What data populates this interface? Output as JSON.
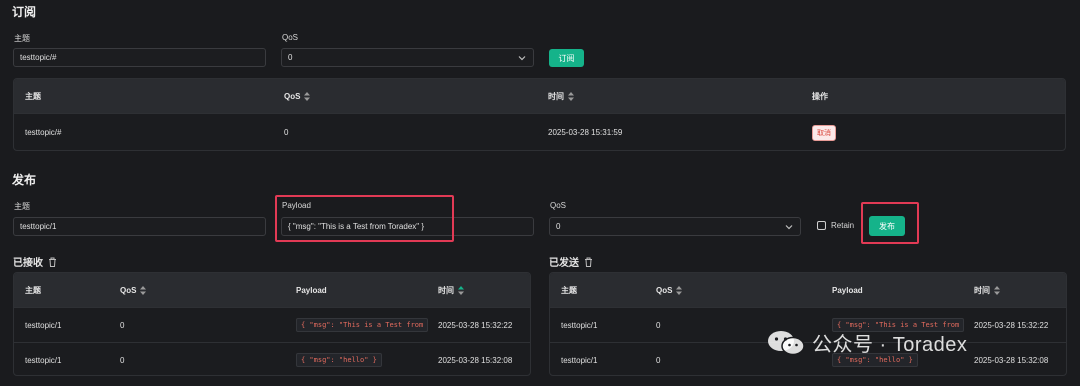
{
  "subscribe": {
    "title": "订阅",
    "topic_label": "主题",
    "topic_value": "testtopic/#",
    "qos_label": "QoS",
    "qos_value": "0",
    "button_label": "订阅",
    "table": {
      "headers": [
        "主题",
        "QoS",
        "时间",
        "操作"
      ],
      "rows": [
        {
          "topic": "testtopic/#",
          "qos": "0",
          "time": "2025-03-28 15:31:59",
          "action": "取消"
        }
      ]
    }
  },
  "publish": {
    "title": "发布",
    "topic_label": "主题",
    "topic_value": "testtopic/1",
    "payload_label": "Payload",
    "payload_value": "{ \"msg\": \"This is a Test from Toradex\" }",
    "qos_label": "QoS",
    "qos_value": "0",
    "retain_label": "Retain",
    "button_label": "发布"
  },
  "received": {
    "title": "已接收",
    "headers": [
      "主题",
      "QoS",
      "Payload",
      "时间"
    ],
    "rows": [
      {
        "topic": "testtopic/1",
        "qos": "0",
        "payload": "{ \"msg\": \"This is a Test from",
        "time": "2025-03-28 15:32:22"
      },
      {
        "topic": "testtopic/1",
        "qos": "0",
        "payload": "{ \"msg\": \"hello\" }",
        "time": "2025-03-28 15:32:08"
      }
    ]
  },
  "sent": {
    "title": "已发送",
    "headers": [
      "主题",
      "QoS",
      "Payload",
      "时间"
    ],
    "rows": [
      {
        "topic": "testtopic/1",
        "qos": "0",
        "payload": "{ \"msg\": \"This is a Test from",
        "time": "2025-03-28 15:32:22"
      },
      {
        "topic": "testtopic/1",
        "qos": "0",
        "payload": "{ \"msg\": \"hello\" }",
        "time": "2025-03-28 15:32:08"
      }
    ]
  },
  "watermark": {
    "text": "公众号 · Toradex"
  },
  "colors": {
    "accent": "#15b38a",
    "highlight": "#e23a55",
    "background": "#1a1b1e",
    "code_text": "#e36b5e"
  }
}
